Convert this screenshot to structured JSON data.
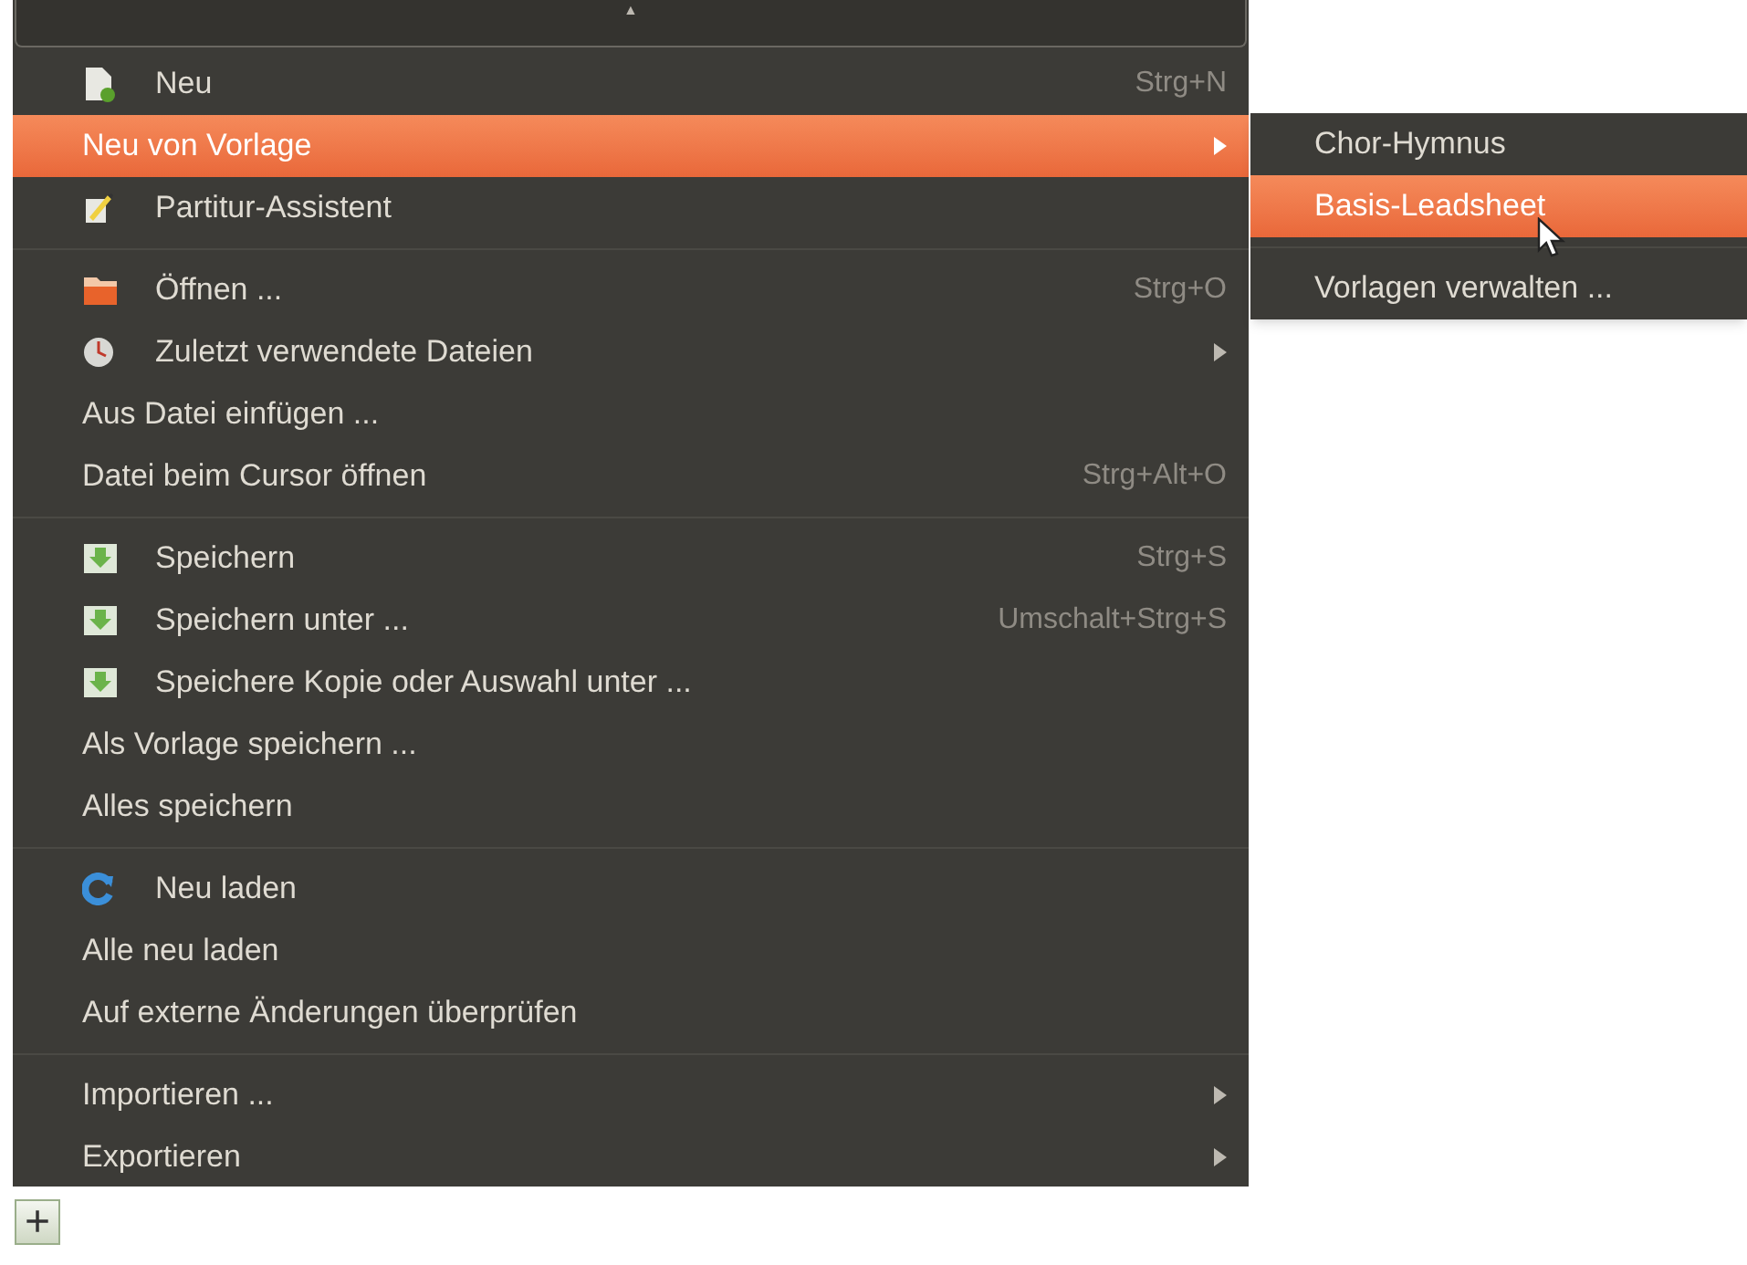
{
  "menu": {
    "scroll_arrow": "▲",
    "items": [
      {
        "kind": "icon_item",
        "label": "Neu",
        "shortcut": "Strg+N",
        "selected": false
      },
      {
        "kind": "item",
        "label": "Neu von Vorlage",
        "submenu": true,
        "selected": true
      },
      {
        "kind": "icon_item",
        "label": "Partitur-Assistent",
        "selected": false
      },
      {
        "kind": "separator"
      },
      {
        "kind": "icon_item",
        "label": "Öffnen ...",
        "shortcut": "Strg+O",
        "selected": false
      },
      {
        "kind": "icon_item",
        "label": "Zuletzt verwendete Dateien",
        "submenu": true,
        "selected": false
      },
      {
        "kind": "item",
        "label": "Aus Datei einfügen ...",
        "selected": false
      },
      {
        "kind": "item",
        "label": "Datei beim Cursor öffnen",
        "shortcut": "Strg+Alt+O",
        "selected": false
      },
      {
        "kind": "separator"
      },
      {
        "kind": "icon_item",
        "label": "Speichern",
        "shortcut": "Strg+S",
        "selected": false
      },
      {
        "kind": "icon_item",
        "label": "Speichern unter ...",
        "shortcut": "Umschalt+Strg+S",
        "selected": false
      },
      {
        "kind": "icon_item",
        "label": "Speichere Kopie oder Auswahl unter ...",
        "selected": false
      },
      {
        "kind": "item",
        "label": "Als Vorlage speichern ...",
        "selected": false
      },
      {
        "kind": "item",
        "label": "Alles speichern",
        "selected": false
      },
      {
        "kind": "separator"
      },
      {
        "kind": "icon_item",
        "label": "Neu laden",
        "selected": false
      },
      {
        "kind": "item",
        "label": "Alle neu laden",
        "selected": false
      },
      {
        "kind": "item",
        "label": "Auf externe Änderungen überprüfen",
        "selected": false
      },
      {
        "kind": "separator"
      },
      {
        "kind": "item",
        "label": "Importieren ...",
        "submenu": true,
        "selected": false
      },
      {
        "kind": "item",
        "label": "Exportieren",
        "submenu": true,
        "selected": false
      }
    ]
  },
  "submenu": {
    "items": [
      {
        "kind": "item",
        "label": "Chor-Hymnus",
        "selected": false
      },
      {
        "kind": "item",
        "label": "Basis-Leadsheet",
        "selected": true
      },
      {
        "kind": "separator"
      },
      {
        "kind": "item",
        "label": "Vorlagen verwalten ...",
        "selected": false
      }
    ]
  },
  "add_button": "+"
}
